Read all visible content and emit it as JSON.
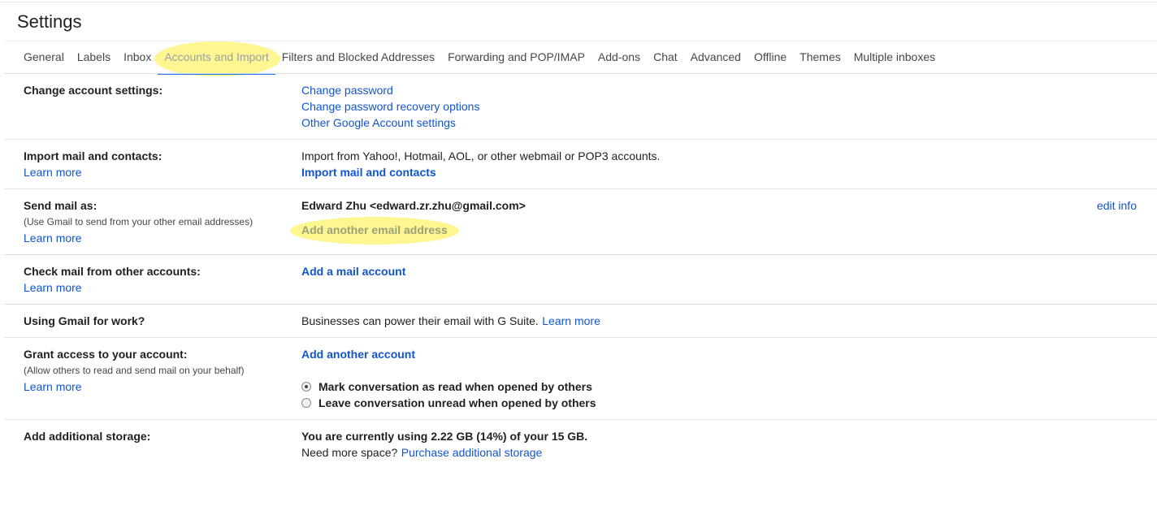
{
  "header": {
    "title": "Settings"
  },
  "tabs": [
    {
      "label": "General"
    },
    {
      "label": "Labels"
    },
    {
      "label": "Inbox"
    },
    {
      "label": "Accounts and Import"
    },
    {
      "label": "Filters and Blocked Addresses"
    },
    {
      "label": "Forwarding and POP/IMAP"
    },
    {
      "label": "Add-ons"
    },
    {
      "label": "Chat"
    },
    {
      "label": "Advanced"
    },
    {
      "label": "Offline"
    },
    {
      "label": "Themes"
    },
    {
      "label": "Multiple inboxes"
    }
  ],
  "active_tab": "Accounts and Import",
  "sections": {
    "change_account": {
      "heading": "Change account settings:",
      "links": [
        "Change password",
        "Change password recovery options",
        "Other Google Account settings"
      ]
    },
    "import_mail": {
      "heading": "Import mail and contacts:",
      "learn_more": "Learn more",
      "description": "Import from Yahoo!, Hotmail, AOL, or other webmail or POP3 accounts.",
      "action": "Import mail and contacts"
    },
    "send_mail_as": {
      "heading": "Send mail as:",
      "sub": "(Use Gmail to send from your other email addresses)",
      "learn_more": "Learn more",
      "identity": "Edward Zhu <edward.zr.zhu@gmail.com>",
      "edit": "edit info",
      "action": "Add another email address"
    },
    "check_mail": {
      "heading": "Check mail from other accounts:",
      "learn_more": "Learn more",
      "action": "Add a mail account"
    },
    "work": {
      "heading": "Using Gmail for work?",
      "description": "Businesses can power their email with G Suite.",
      "learn_more": "Learn more"
    },
    "grant_access": {
      "heading": "Grant access to your account:",
      "sub": "(Allow others to read and send mail on your behalf)",
      "learn_more": "Learn more",
      "action": "Add another account",
      "options": [
        {
          "label": "Mark conversation as read when opened by others",
          "checked": true
        },
        {
          "label": "Leave conversation unread when opened by others",
          "checked": false
        }
      ]
    },
    "storage": {
      "heading": "Add additional storage:",
      "usage": "You are currently using 2.22 GB (14%) of your 15 GB.",
      "need_more": "Need more space?",
      "purchase": "Purchase additional storage"
    }
  },
  "colors": {
    "link": "#1155cc",
    "highlight": "#fdf36b",
    "active_tab_underline": "#1a73e8"
  }
}
